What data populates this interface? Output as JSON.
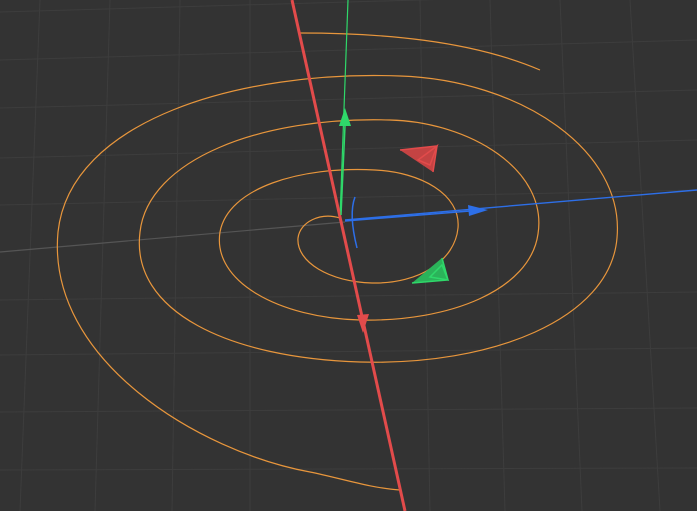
{
  "viewport": {
    "background_color": "#333333",
    "grid_color": "#3d3d3d",
    "horizon_line_color": "#4a4a4a",
    "spiral_color": "#e8963c"
  },
  "axes": {
    "x_axis": {
      "name": "x-axis",
      "color": "#e24b4b"
    },
    "y_axis": {
      "name": "y-axis",
      "color": "#2fd86a"
    },
    "z_axis": {
      "name": "z-axis",
      "color": "#2d6fe8"
    }
  },
  "gizmo": {
    "x_handle_color": "#e24b4b",
    "y_handle_color": "#2fd86a",
    "z_handle_color": "#2d6fe8",
    "x_plane_handle_icon": "plane-handle-icon",
    "y_plane_handle_icon": "plane-handle-icon"
  }
}
